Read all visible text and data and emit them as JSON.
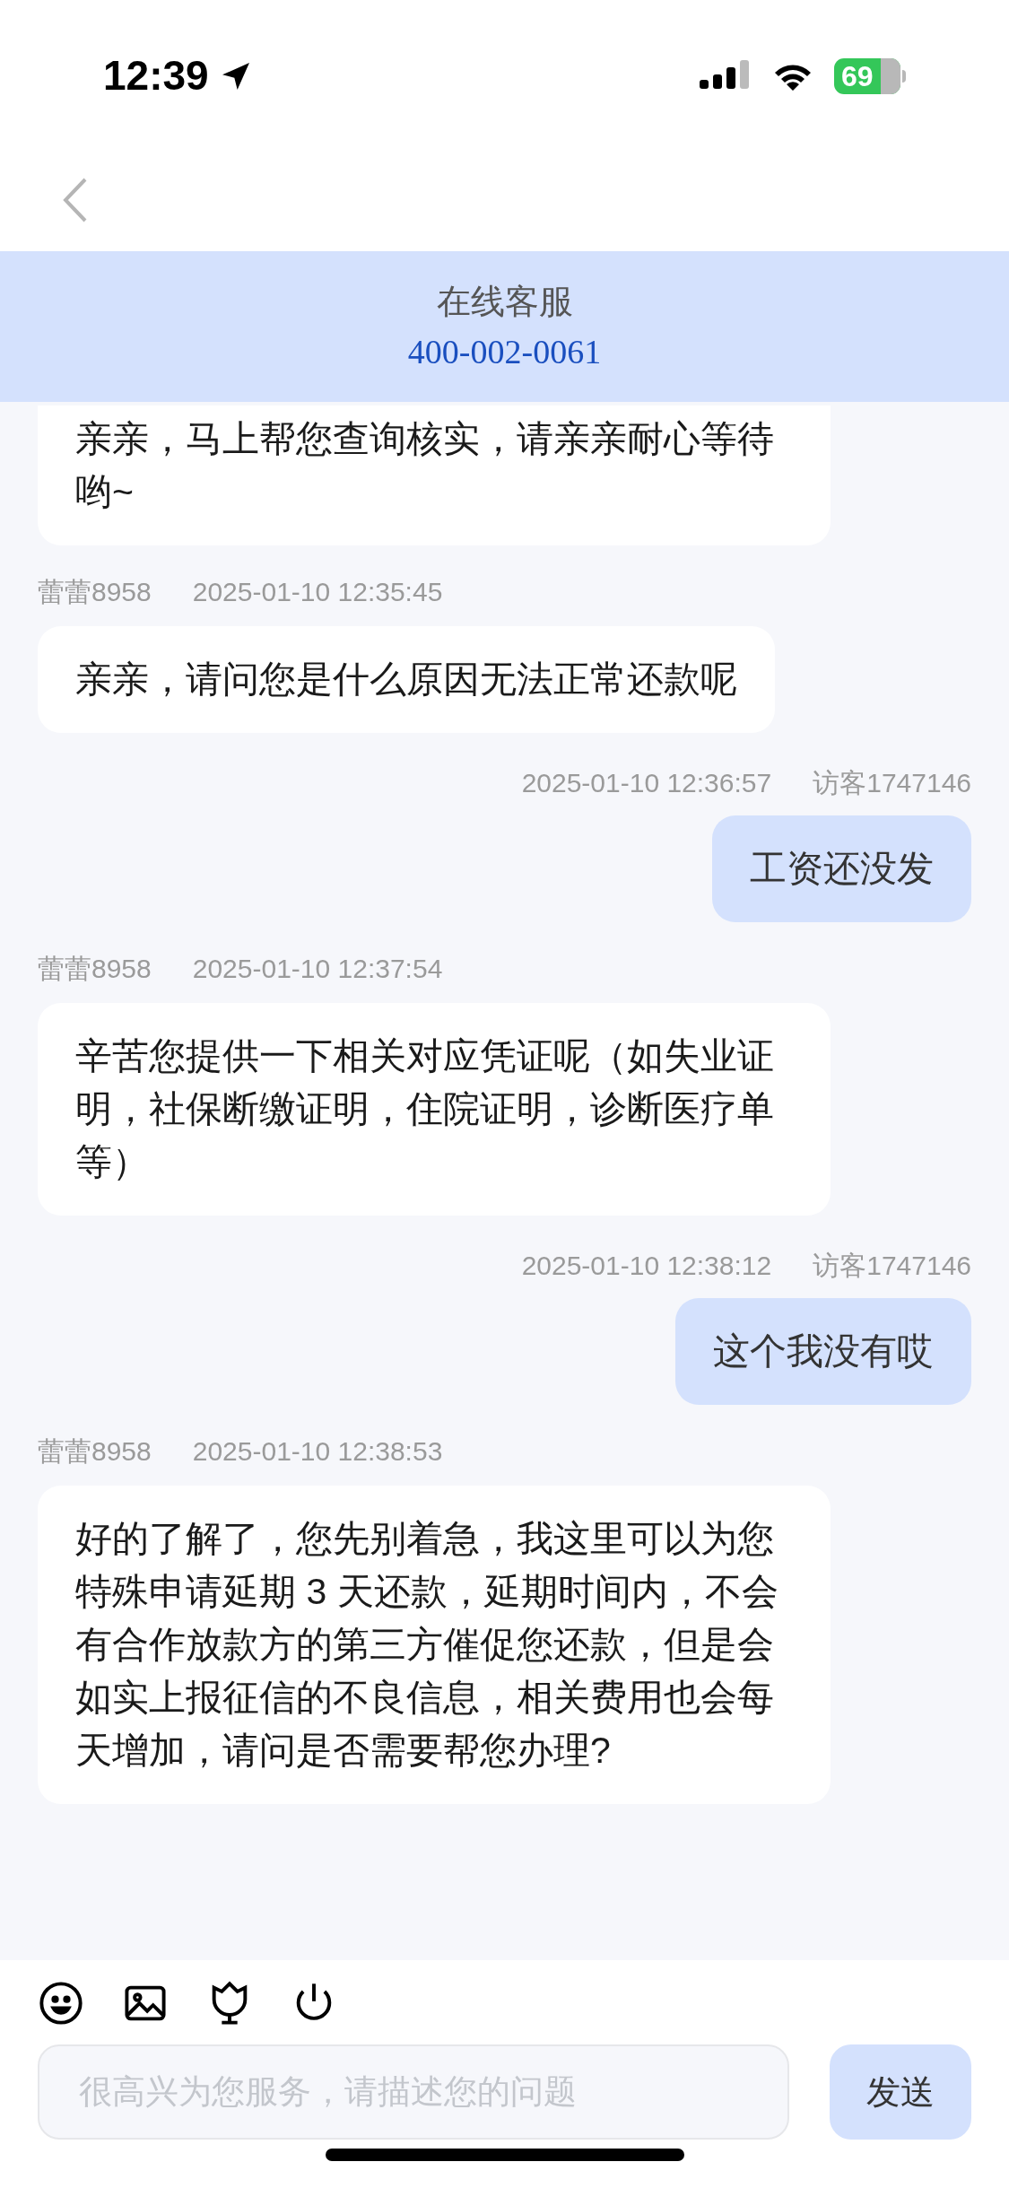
{
  "status_bar": {
    "time": "12:39",
    "battery": "69"
  },
  "header": {
    "title": "在线客服",
    "phone": "400-002-0061"
  },
  "messages": [
    {
      "kind": "agent",
      "text": "亲亲，马上帮您查询核实，请亲亲耐心等待哟~"
    },
    {
      "kind": "agent",
      "sender": "蕾蕾8958",
      "time": "2025-01-10 12:35:45",
      "text": "亲亲，请问您是什么原因无法正常还款呢"
    },
    {
      "kind": "visitor",
      "sender": "访客1747146",
      "time": "2025-01-10 12:36:57",
      "text": "工资还没发"
    },
    {
      "kind": "agent",
      "sender": "蕾蕾8958",
      "time": "2025-01-10 12:37:54",
      "text": "辛苦您提供一下相关对应凭证呢（如失业证明，社保断缴证明，住院证明，诊断医疗单等）"
    },
    {
      "kind": "visitor",
      "sender": "访客1747146",
      "time": "2025-01-10 12:38:12",
      "text": "这个我没有哎"
    },
    {
      "kind": "agent",
      "sender": "蕾蕾8958",
      "time": "2025-01-10 12:38:53",
      "text": "好的了解了，您先别着急，我这里可以为您特殊申请延期 3 天还款，延期时间内，不会有合作放款方的第三方催促您还款，但是会如实上报征信的不良信息，相关费用也会每天增加，请问是否需要帮您办理?"
    }
  ],
  "composer": {
    "placeholder": "很高兴为您服务，请描述您的问题",
    "send": "发送"
  }
}
